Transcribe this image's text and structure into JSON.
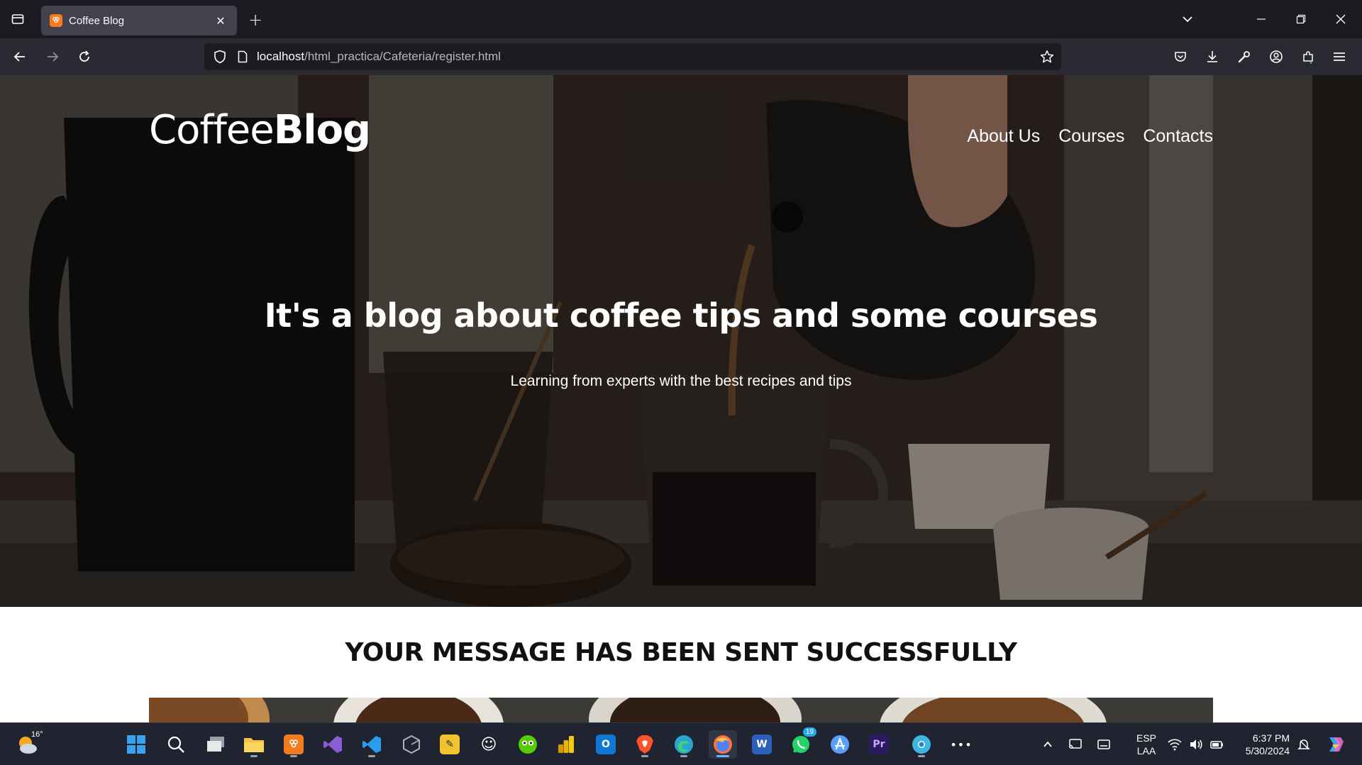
{
  "browser": {
    "tab": {
      "title": "Coffee Blog",
      "favicon_text": "ꕢ"
    },
    "url": {
      "host": "localhost",
      "path": "/html_practica/Cafeteria/register.html"
    },
    "icons": {
      "tab_list": "tab-list-icon",
      "new_tab": "+",
      "tab_close": "✕",
      "list_all_tabs": "chevron-down-icon",
      "minimize": "minimize-icon",
      "restore": "restore-icon",
      "close": "close-icon",
      "back": "back-arrow-icon",
      "forward": "forward-arrow-icon",
      "reload": "reload-icon",
      "shield": "shield-icon",
      "page": "page-icon",
      "bookmark": "star-icon",
      "pocket": "pocket-icon",
      "downloads": "download-icon",
      "tools": "wrench-icon",
      "account": "account-icon",
      "extensions": "extensions-icon",
      "menu": "hamburger-menu-icon"
    }
  },
  "page": {
    "logo": {
      "light": "Coffee",
      "bold": "Blog"
    },
    "nav": [
      "About Us",
      "Courses",
      "Contacts"
    ],
    "hero": {
      "title": "It's a blog about coffee tips and some courses",
      "subtitle": "Learning from experts with the best recipes and tips"
    },
    "success_message": "YOUR MESSAGE HAS BEEN SENT SUCCESSFULLY"
  },
  "taskbar": {
    "weather_temp": "16°",
    "apps": [
      {
        "name": "start",
        "color": "#3aa0f0"
      },
      {
        "name": "search",
        "color": "#ffffff"
      },
      {
        "name": "task-view",
        "color": "#dddddd"
      },
      {
        "name": "file-explorer",
        "color": "#f5c542"
      },
      {
        "name": "xampp",
        "color": "#f37c21"
      },
      {
        "name": "visual-studio",
        "color": "#8a5cd6"
      },
      {
        "name": "vs-code",
        "color": "#2d9cf0"
      },
      {
        "name": "unity",
        "color": "#7c8595"
      },
      {
        "name": "sticky-app",
        "color": "#f2c230"
      },
      {
        "name": "emoji-app",
        "color": "#f4d35e"
      },
      {
        "name": "duolingo",
        "color": "#58cc02"
      },
      {
        "name": "power-bi",
        "color": "#f2c811"
      },
      {
        "name": "outlook-new",
        "color": "#0f78d4"
      },
      {
        "name": "brave",
        "color": "#fb542b"
      },
      {
        "name": "edge",
        "color": "#2aa4d8"
      },
      {
        "name": "firefox",
        "color": "#4f82ff"
      },
      {
        "name": "word",
        "color": "#2b5fb9"
      },
      {
        "name": "whatsapp",
        "color": "#25d366"
      },
      {
        "name": "app-store-like",
        "color": "#5aa0ff"
      },
      {
        "name": "premiere-pro",
        "color": "#2a1a5e"
      },
      {
        "name": "chrome-like",
        "color": "#3fb6e0"
      }
    ],
    "whatsapp_badge": "19",
    "more": "•••",
    "lang": {
      "code": "ESP",
      "layout": "LAA"
    },
    "clock": {
      "time": "6:37 PM",
      "date": "5/30/2024"
    }
  }
}
